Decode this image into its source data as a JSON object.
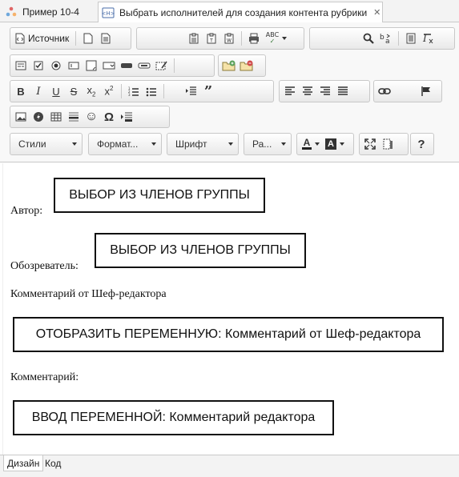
{
  "tabs": [
    {
      "label": "Пример 10-4"
    },
    {
      "label": "Выбрать исполнителей для создания контента рубрики"
    }
  ],
  "toolbar": {
    "source_label": "Источник",
    "styles_label": "Стили",
    "format_label": "Формат...",
    "font_label": "Шрифт",
    "size_label": "Ра...",
    "spell_label": "ABC",
    "help_label": "?",
    "omega_label": "Ω",
    "smiley_label": "☺"
  },
  "editor": {
    "author_label": "Автор:",
    "author_box": "ВЫБОР ИЗ ЧЛЕНОВ ГРУППЫ",
    "reviewer_label": "Обозреватель:",
    "reviewer_box": "ВЫБОР ИЗ ЧЛЕНОВ ГРУППЫ",
    "chief_comment_label": "Комментарий от Шеф-редактора",
    "chief_comment_box": "ОТОБРАЗИТЬ ПЕРЕМЕННУЮ: Комментарий от Шеф-редактора",
    "comment_label": "Комментарий:",
    "comment_box": "ВВОД ПЕРЕМЕННОЙ: Комментарий редактора"
  },
  "bottom_tabs": [
    {
      "label": "Дизайн"
    },
    {
      "label": "Код"
    }
  ]
}
